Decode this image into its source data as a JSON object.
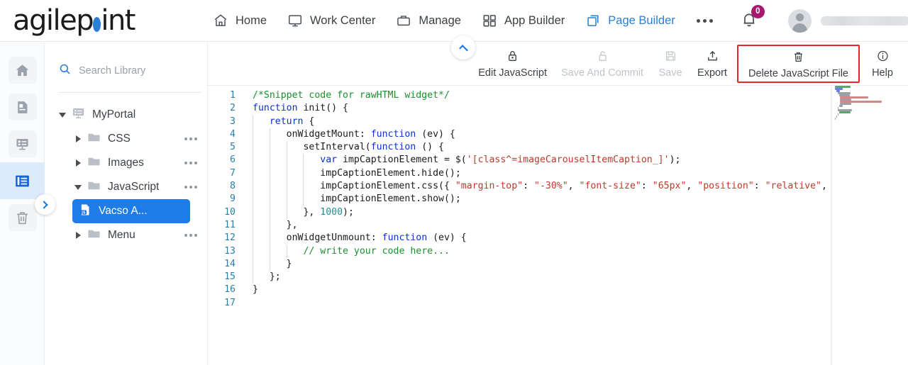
{
  "brand": {
    "name_part1": "agilep",
    "name_part2": "int",
    "accent": "#2a7fd4"
  },
  "header": {
    "nav": [
      {
        "label": "Home",
        "icon": "home-icon",
        "active": false
      },
      {
        "label": "Work Center",
        "icon": "monitor-icon",
        "active": false
      },
      {
        "label": "Manage",
        "icon": "briefcase-icon",
        "active": false
      },
      {
        "label": "App Builder",
        "icon": "grid-icon",
        "active": false
      },
      {
        "label": "Page Builder",
        "icon": "pages-icon",
        "active": true
      }
    ],
    "more_label": "more-menu",
    "notification_count": "0",
    "notification_badge_color": "#a6186e",
    "user_name_redacted": true
  },
  "left_rail": {
    "items": [
      {
        "name": "home",
        "icon": "home-icon",
        "active": false
      },
      {
        "name": "page",
        "icon": "page-document-icon",
        "active": false
      },
      {
        "name": "form-layout",
        "icon": "form-layout-icon",
        "active": false
      },
      {
        "name": "library",
        "icon": "library-icon",
        "active": true
      },
      {
        "name": "trash",
        "icon": "trash-icon",
        "active": false
      }
    ],
    "expand_toggle_icon": "chevron-right-icon"
  },
  "library_panel": {
    "search_placeholder": "Search Library",
    "search_value": "",
    "search_icon": "search-icon",
    "tree": [
      {
        "label": "MyPortal",
        "level": 0,
        "caret": "down",
        "icon": "portal-icon",
        "menu": false,
        "selected": false
      },
      {
        "label": "CSS",
        "level": 1,
        "caret": "right",
        "icon": "folder-icon",
        "menu": true,
        "selected": false
      },
      {
        "label": "Images",
        "level": 1,
        "caret": "right",
        "icon": "folder-icon",
        "menu": true,
        "selected": false
      },
      {
        "label": "JavaScript",
        "level": 1,
        "caret": "down",
        "icon": "folder-icon",
        "menu": true,
        "selected": false
      },
      {
        "label": "Vacso A...",
        "level": 2,
        "caret": "none",
        "icon": "js-file-icon",
        "menu": false,
        "selected": true
      },
      {
        "label": "Menu",
        "level": 1,
        "caret": "right",
        "icon": "folder-icon",
        "menu": true,
        "selected": false
      }
    ]
  },
  "toolbar": {
    "items": [
      {
        "label": "Edit JavaScript",
        "icon": "lock-icon",
        "disabled": false,
        "highlighted": false
      },
      {
        "label": "Save And Commit",
        "icon": "unlock-icon",
        "disabled": true,
        "highlighted": false
      },
      {
        "label": "Save",
        "icon": "floppy-disk-icon",
        "disabled": true,
        "highlighted": false
      },
      {
        "label": "Export",
        "icon": "upload-icon",
        "disabled": false,
        "highlighted": false
      },
      {
        "label": "Delete JavaScript File",
        "icon": "trash-icon",
        "disabled": false,
        "highlighted": true
      },
      {
        "label": "Help",
        "icon": "info-circle-icon",
        "disabled": false,
        "highlighted": false
      }
    ],
    "highlight_color": "#e8252a"
  },
  "collapse_button": {
    "icon": "chevron-up-icon"
  },
  "editor": {
    "language": "javascript",
    "total_lines": 17,
    "lines": [
      {
        "n": "1",
        "code": "/*Snippet code for rawHTML widget*/"
      },
      {
        "n": "2",
        "code": "function init() {"
      },
      {
        "n": "3",
        "code": "   return {"
      },
      {
        "n": "4",
        "code": "      onWidgetMount: function (ev) {"
      },
      {
        "n": "5",
        "code": "         setInterval(function () {"
      },
      {
        "n": "6",
        "code": "            var impCaptionElement = $('[class^=imageCarouselItemCaption_]');"
      },
      {
        "n": "7",
        "code": "            impCaptionElement.hide();"
      },
      {
        "n": "8",
        "code": "            impCaptionElement.css({ \"margin-top\": \"-30%\", \"font-size\": \"65px\", \"position\": \"relative\", \"bac"
      },
      {
        "n": "9",
        "code": "            impCaptionElement.show();"
      },
      {
        "n": "10",
        "code": "         }, 1000);"
      },
      {
        "n": "11",
        "code": "      },"
      },
      {
        "n": "12",
        "code": "      onWidgetUnmount: function (ev) {"
      },
      {
        "n": "13",
        "code": "         // write your code here..."
      },
      {
        "n": "14",
        "code": "      }"
      },
      {
        "n": "15",
        "code": "   };"
      },
      {
        "n": "16",
        "code": "}"
      },
      {
        "n": "17",
        "code": ""
      }
    ],
    "colors": {
      "line_number": "#2b7fa8",
      "keyword": "#0b32cf",
      "comment": "#1a8f2f",
      "string": "#c0392b",
      "number": "#1e8f8f",
      "plain": "#1b1b1b"
    }
  }
}
